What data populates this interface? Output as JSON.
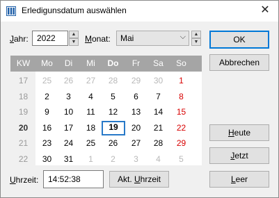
{
  "window": {
    "title": "Erledigunsdatum auswählen",
    "close_glyph": "✕"
  },
  "year": {
    "label": "Jahr:",
    "value": "2022"
  },
  "month": {
    "label": "Monat:",
    "value": "Mai"
  },
  "calendar": {
    "headers": [
      "KW",
      "Mo",
      "Di",
      "Mi",
      "Do",
      "Fr",
      "Sa",
      "So"
    ],
    "weeks": [
      {
        "kw": "17",
        "days": [
          "25",
          "26",
          "27",
          "28",
          "29",
          "30",
          "1"
        ]
      },
      {
        "kw": "18",
        "days": [
          "2",
          "3",
          "4",
          "5",
          "6",
          "7",
          "8"
        ]
      },
      {
        "kw": "19",
        "days": [
          "9",
          "10",
          "11",
          "12",
          "13",
          "14",
          "15"
        ]
      },
      {
        "kw": "20",
        "days": [
          "16",
          "17",
          "18",
          "19",
          "20",
          "21",
          "22"
        ]
      },
      {
        "kw": "21",
        "days": [
          "23",
          "24",
          "25",
          "26",
          "27",
          "28",
          "29"
        ]
      },
      {
        "kw": "22",
        "days": [
          "30",
          "31",
          "1",
          "2",
          "3",
          "4",
          "5"
        ]
      }
    ],
    "selected_day": "19",
    "accent_color": "#2879c8",
    "sunday_color": "#d80000"
  },
  "time": {
    "label": "Uhrzeit:",
    "value": "14:52:38"
  },
  "buttons": {
    "current_time": "Akt. Uhrzeit",
    "ok": "OK",
    "cancel": "Abbrechen",
    "today": "Heute",
    "now": "Jetzt",
    "empty": "Leer"
  }
}
